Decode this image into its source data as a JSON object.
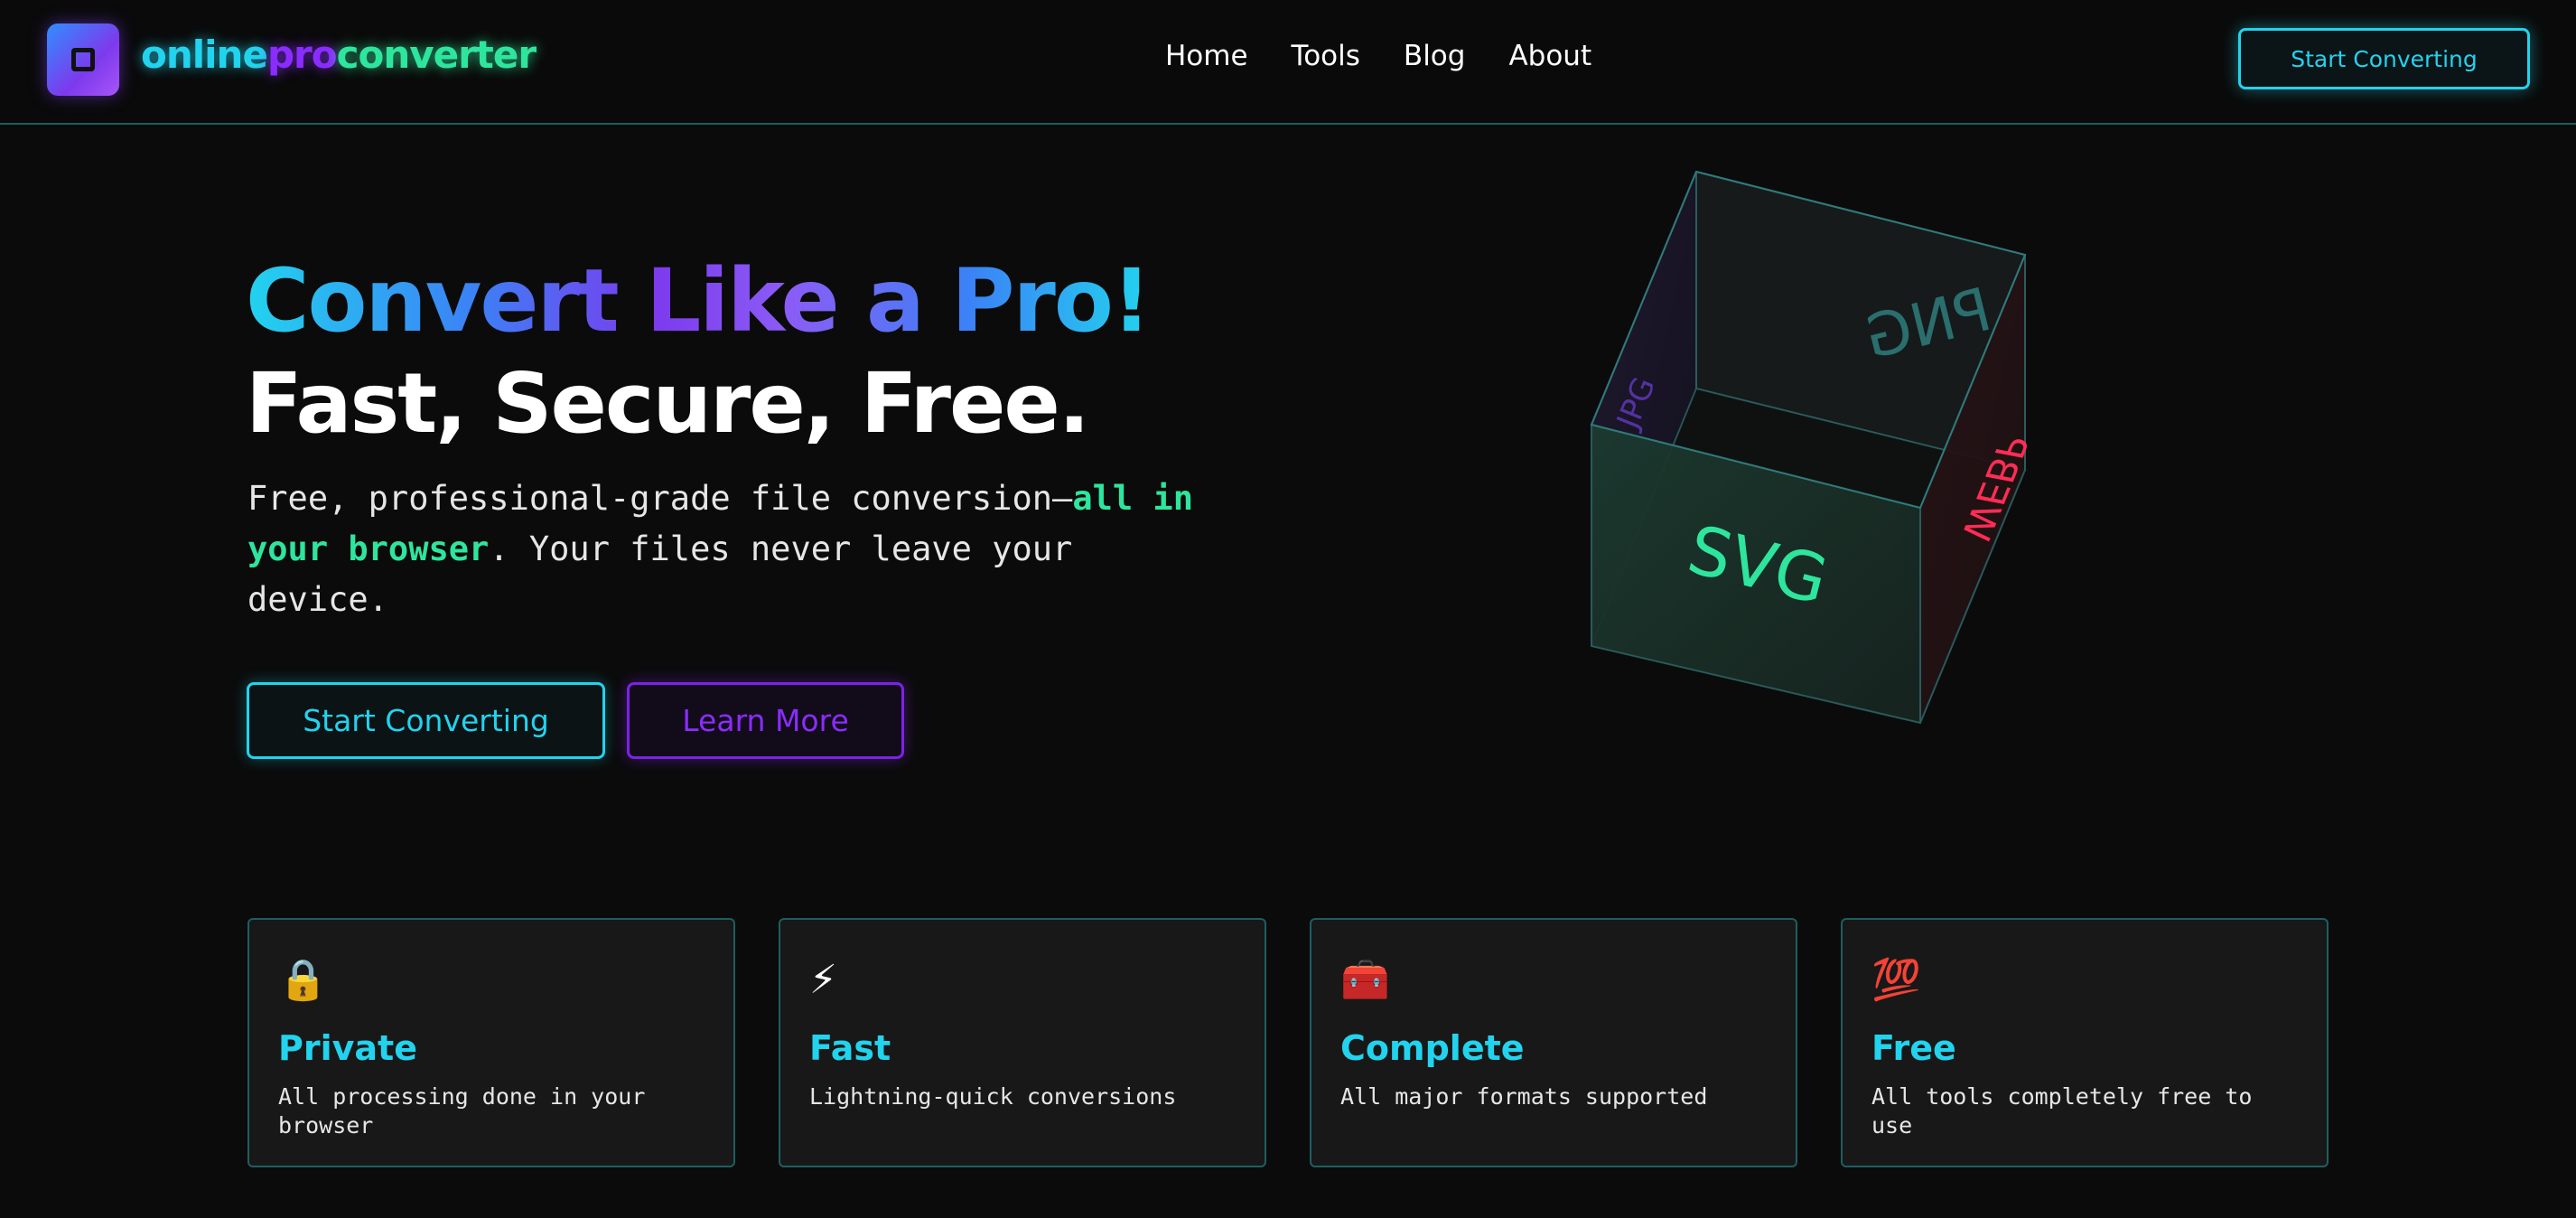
{
  "brand": {
    "part1": "online",
    "part2": "pro",
    "part3": "converter"
  },
  "nav": {
    "items": [
      {
        "label": "Home"
      },
      {
        "label": "Tools"
      },
      {
        "label": "Blog"
      },
      {
        "label": "About"
      }
    ],
    "cta_label": "Start Converting"
  },
  "hero": {
    "title_line1": "Convert Like a Pro!",
    "title_line2": "Fast, Secure, Free.",
    "desc_before": "Free, professional-grade file conversion—",
    "desc_highlight": "all in your browser",
    "desc_after": ". Your files never leave your device.",
    "primary_button": "Start Converting",
    "secondary_button": "Learn More"
  },
  "cube": {
    "front_label": "SVG",
    "back_label": "PNG",
    "right_label": "WEBP",
    "left_label": "JPG"
  },
  "features": [
    {
      "icon": "🔒",
      "icon_name": "lock-icon",
      "title": "Private",
      "desc": "All processing done in your browser"
    },
    {
      "icon": "⚡",
      "icon_name": "lightning-icon",
      "title": "Fast",
      "desc": "Lightning-quick conversions"
    },
    {
      "icon": "🧰",
      "icon_name": "toolbox-icon",
      "title": "Complete",
      "desc": "All major formats supported"
    },
    {
      "icon": "💯",
      "icon_name": "hundred-points-icon",
      "title": "Free",
      "desc": "All tools completely free to use"
    }
  ],
  "colors": {
    "background": "#0b0b0b",
    "accent_cyan": "#22d3ee",
    "accent_purple": "#8b2cff",
    "accent_green": "#2ee59d",
    "accent_red": "#ff2d55"
  }
}
